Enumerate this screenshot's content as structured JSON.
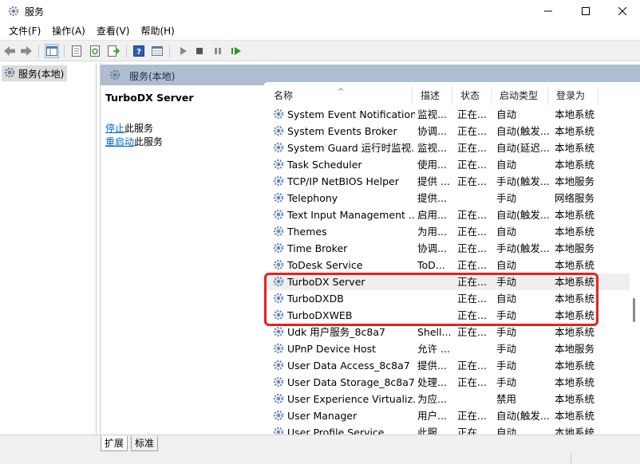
{
  "window": {
    "title": "服务"
  },
  "menubar": {
    "items": [
      "文件(F)",
      "操作(A)",
      "查看(V)",
      "帮助(H)"
    ]
  },
  "tree": {
    "selected_label": "服务(本地)"
  },
  "pane": {
    "header_title": "服务(本地)",
    "selected_service": "TurboDX Server",
    "actions": [
      {
        "link": "停止",
        "suffix": "此服务"
      },
      {
        "link": "重启动",
        "suffix": "此服务"
      }
    ]
  },
  "columns": {
    "name": "名称",
    "desc": "描述",
    "status": "状态",
    "startup": "启动类型",
    "logon": "登录为"
  },
  "services": [
    {
      "name": "System Event Notification...",
      "desc": "监视...",
      "status": "正在...",
      "startup": "自动",
      "logon": "本地系统"
    },
    {
      "name": "System Events Broker",
      "desc": "协调...",
      "status": "正在...",
      "startup": "自动(触发...",
      "logon": "本地系统"
    },
    {
      "name": "System Guard 运行时监视...",
      "desc": "监视...",
      "status": "正在...",
      "startup": "自动(延迟...",
      "logon": "本地系统"
    },
    {
      "name": "Task Scheduler",
      "desc": "使用...",
      "status": "正在...",
      "startup": "自动",
      "logon": "本地系统"
    },
    {
      "name": "TCP/IP NetBIOS Helper",
      "desc": "提供 ...",
      "status": "正在...",
      "startup": "手动(触发...",
      "logon": "本地服务"
    },
    {
      "name": "Telephony",
      "desc": "提供...",
      "status": "",
      "startup": "手动",
      "logon": "网络服务"
    },
    {
      "name": "Text Input Management ...",
      "desc": "启用...",
      "status": "正在...",
      "startup": "自动(触发...",
      "logon": "本地系统"
    },
    {
      "name": "Themes",
      "desc": "为用...",
      "status": "正在...",
      "startup": "自动",
      "logon": "本地系统"
    },
    {
      "name": "Time Broker",
      "desc": "协调...",
      "status": "正在...",
      "startup": "手动(触发...",
      "logon": "本地服务"
    },
    {
      "name": "ToDesk Service",
      "desc": "ToD...",
      "status": "正在...",
      "startup": "自动",
      "logon": "本地系统"
    },
    {
      "name": "TurboDX Server",
      "desc": "",
      "status": "正在...",
      "startup": "手动",
      "logon": "本地系统"
    },
    {
      "name": "TurboDXDB",
      "desc": "",
      "status": "正在...",
      "startup": "自动",
      "logon": "本地系统"
    },
    {
      "name": "TurboDXWEB",
      "desc": "",
      "status": "正在...",
      "startup": "手动",
      "logon": "本地系统"
    },
    {
      "name": "Udk 用户服务_8c8a7",
      "desc": "Shell...",
      "status": "正在...",
      "startup": "手动",
      "logon": "本地系统"
    },
    {
      "name": "UPnP Device Host",
      "desc": "允许 ...",
      "status": "",
      "startup": "手动",
      "logon": "本地服务"
    },
    {
      "name": "User Data Access_8c8a7",
      "desc": "提供...",
      "status": "正在...",
      "startup": "手动",
      "logon": "本地系统"
    },
    {
      "name": "User Data Storage_8c8a7",
      "desc": "处理...",
      "status": "正在...",
      "startup": "手动",
      "logon": "本地系统"
    },
    {
      "name": "User Experience Virtualiz...",
      "desc": "为应...",
      "status": "",
      "startup": "禁用",
      "logon": "本地系统"
    },
    {
      "name": "User Manager",
      "desc": "用户...",
      "status": "正在...",
      "startup": "自动(触发...",
      "logon": "本地系统"
    },
    {
      "name": "User Profile Service",
      "desc": "此服...",
      "status": "正在...",
      "startup": "自动",
      "logon": "本地系统"
    }
  ],
  "bottom_tabs": [
    "扩展",
    "标准"
  ],
  "colors": {
    "header_bg": "#aebdd0",
    "highlight": "#e8201f",
    "link": "#0066cc"
  }
}
